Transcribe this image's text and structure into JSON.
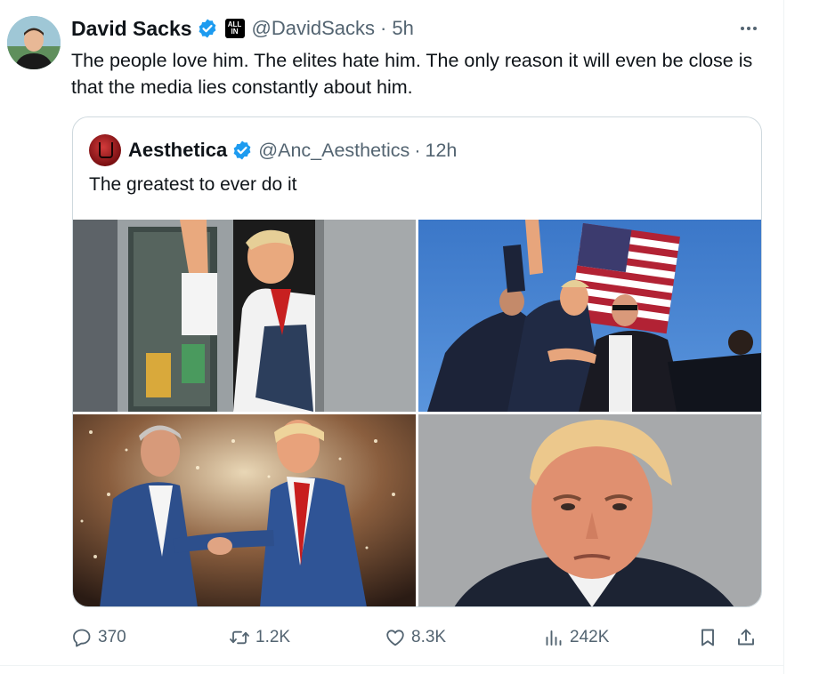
{
  "tweet": {
    "author": {
      "display_name": "David Sacks",
      "handle": "@DavidSacks",
      "affiliate_badge": "ALL IN",
      "verified_color": "#1d9bf0"
    },
    "separator": "·",
    "time": "5h",
    "text": "The people love him. The elites hate him. The only reason it will even be close is that the media lies constantly about him.",
    "quoted": {
      "display_name": "Aesthetica",
      "handle": "@Anc_Aesthetics",
      "time": "12h",
      "text": "The greatest to ever do it",
      "images": [
        {
          "icon": "drive-thru-window-photo"
        },
        {
          "icon": "rally-flag-photo"
        },
        {
          "icon": "handshake-stage-photo"
        },
        {
          "icon": "portrait-photo"
        }
      ]
    },
    "actions": {
      "replies": "370",
      "reposts": "1.2K",
      "likes": "8.3K",
      "views": "242K"
    }
  },
  "colors": {
    "text_primary": "#0f1419",
    "text_secondary": "#536471",
    "border": "#cfd9de",
    "accent": "#1d9bf0"
  }
}
